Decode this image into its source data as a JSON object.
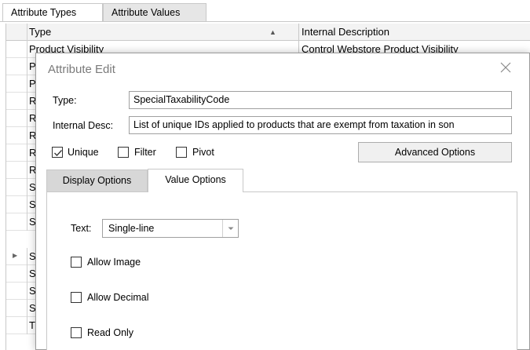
{
  "top_tabs": {
    "types": "Attribute Types",
    "values": "Attribute Values"
  },
  "grid": {
    "headers": {
      "type": "Type",
      "desc": "Internal Description"
    },
    "rows": [
      {
        "type": "Product Visibility",
        "desc": "Control Webstore Product Visibility"
      },
      {
        "type": "P",
        "desc": ""
      },
      {
        "type": "R",
        "desc": ""
      },
      {
        "type": "R",
        "desc": ""
      },
      {
        "type": "R",
        "desc": ""
      },
      {
        "type": "R",
        "desc": ""
      },
      {
        "type": "R",
        "desc": ""
      },
      {
        "type": "S",
        "desc": ""
      },
      {
        "type": "S",
        "desc": ""
      },
      {
        "type": "S",
        "desc": ""
      },
      {
        "type": "S",
        "desc": ""
      },
      {
        "type": "S",
        "desc": ""
      },
      {
        "type": "S",
        "desc": ""
      },
      {
        "type": "S",
        "desc": ""
      },
      {
        "type": "T",
        "desc": ""
      }
    ]
  },
  "dialog": {
    "title": "Attribute Edit",
    "type_label": "Type:",
    "type_value": "SpecialTaxabilityCode",
    "desc_label": "Internal Desc:",
    "desc_value": "List of unique IDs applied to products that are exempt from taxation in son",
    "unique_label": "Unique",
    "filter_label": "Filter",
    "pivot_label": "Pivot",
    "unique_checked": true,
    "filter_checked": false,
    "pivot_checked": false,
    "advanced_button": "Advanced Options",
    "tabs": {
      "display": "Display Options",
      "value": "Value Options"
    },
    "text_label": "Text:",
    "text_value": "Single-line",
    "allow_image": "Allow Image",
    "allow_decimal": "Allow Decimal",
    "read_only": "Read Only"
  },
  "colors": {
    "border": "#c8c8c8",
    "inactive_tab": "#d7d7d7"
  }
}
